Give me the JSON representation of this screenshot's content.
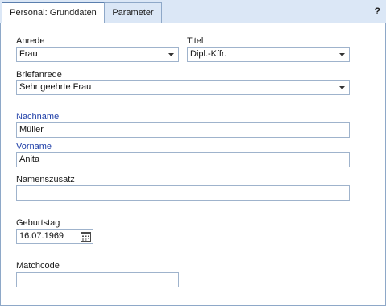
{
  "tabs": [
    {
      "label": "Personal: Grunddaten",
      "active": true
    },
    {
      "label": "Parameter",
      "active": false
    }
  ],
  "help_label": "?",
  "form": {
    "anrede": {
      "label": "Anrede",
      "value": "Frau"
    },
    "titel": {
      "label": "Titel",
      "value": "Dipl.-Kffr."
    },
    "briefanrede": {
      "label": "Briefanrede",
      "value": "Sehr geehrte Frau"
    },
    "nachname": {
      "label": "Nachname",
      "value": "Müller"
    },
    "vorname": {
      "label": "Vorname",
      "value": "Anita"
    },
    "namenszusatz": {
      "label": "Namenszusatz",
      "value": ""
    },
    "geburtstag": {
      "label": "Geburtstag",
      "value": "16.07.1969"
    },
    "matchcode": {
      "label": "Matchcode",
      "value": ""
    }
  },
  "icons": {
    "dropdown": "chevron-down-icon",
    "calendar": "calendar-icon"
  },
  "colors": {
    "required_label": "#1f3fa8",
    "tab_accent": "#5b7fae",
    "frame": "#dbe7f6",
    "field_border": "#9fb3cc"
  }
}
